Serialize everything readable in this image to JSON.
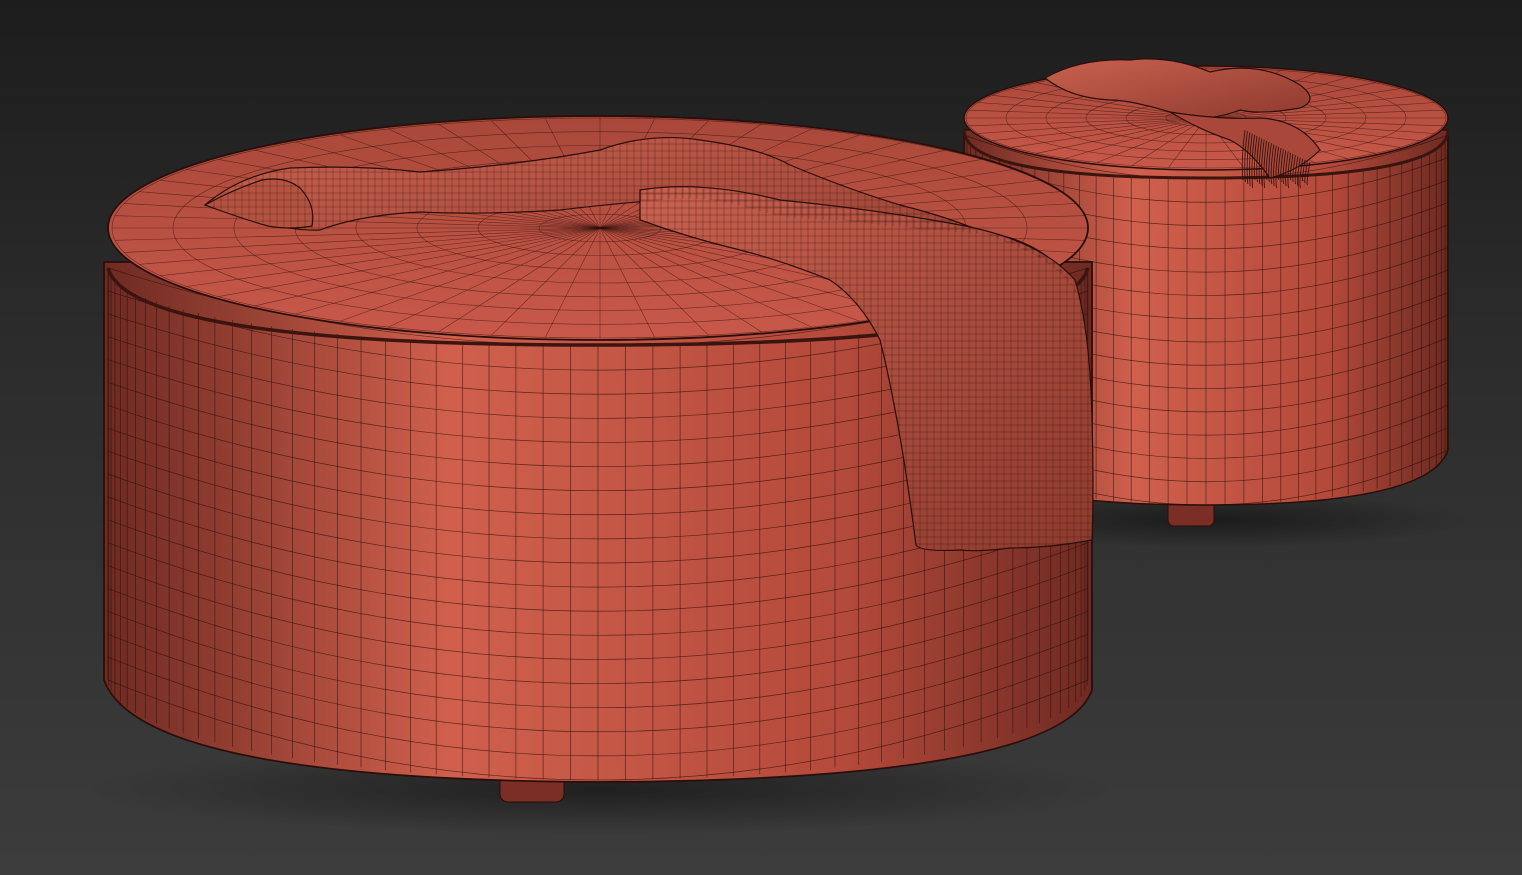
{
  "viewport": {
    "background_top": "#1d1d1d",
    "background_bottom": "#3c3c3c"
  },
  "material": {
    "base_color": "#b44a3b",
    "shadow_color": "#6e2a22",
    "highlight_color": "#d0604d",
    "wire_color": "#2a0e0a"
  },
  "objects": [
    {
      "name": "large-round-pouf",
      "feature": "draped-throw-blanket"
    },
    {
      "name": "small-round-pouf",
      "feature": "folded-throw-with-fringe"
    }
  ]
}
